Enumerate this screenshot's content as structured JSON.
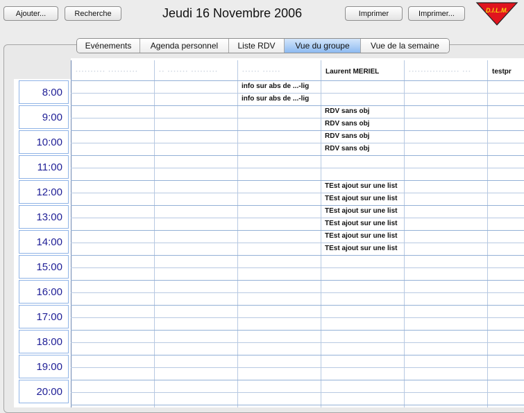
{
  "toolbar": {
    "add_label": "Ajouter...",
    "search_label": "Recherche",
    "date_title": "Jeudi 16 Novembre 2006",
    "print_label": "Imprimer",
    "print_more_label": "Imprimer..."
  },
  "logo": {
    "text": "D.I.L.M.",
    "color": "#e0141e",
    "text_color": "#f5d60a"
  },
  "tabs": [
    {
      "label": "Evénements",
      "active": false
    },
    {
      "label": "Agenda personnel",
      "active": false
    },
    {
      "label": "Liste RDV",
      "active": false
    },
    {
      "label": "Vue du groupe",
      "active": true
    },
    {
      "label": "Vue de la semaine",
      "active": false
    }
  ],
  "columns": [
    {
      "name": "·········· ··········",
      "redacted": true
    },
    {
      "name": "·· ······· ·········",
      "redacted": true
    },
    {
      "name": "······ ······",
      "redacted": true
    },
    {
      "name": "Laurent MERIEL",
      "redacted": false
    },
    {
      "name": "················· ···",
      "redacted": true
    },
    {
      "name": "testpr",
      "redacted": false
    }
  ],
  "times": [
    "8:00",
    "9:00",
    "10:00",
    "11:00",
    "12:00",
    "13:00",
    "14:00",
    "15:00",
    "16:00",
    "17:00",
    "18:00",
    "19:00",
    "20:00"
  ],
  "events": [
    {
      "column": 2,
      "slot": 0,
      "text": "info sur abs de ...-lig"
    },
    {
      "column": 2,
      "slot": 1,
      "text": "info sur abs de ...-lig"
    },
    {
      "column": 3,
      "slot": 2,
      "text": "RDV sans obj"
    },
    {
      "column": 3,
      "slot": 3,
      "text": "RDV sans obj"
    },
    {
      "column": 3,
      "slot": 4,
      "text": "RDV sans obj"
    },
    {
      "column": 3,
      "slot": 5,
      "text": "RDV sans obj"
    },
    {
      "column": 3,
      "slot": 8,
      "text": "TEst ajout sur une list"
    },
    {
      "column": 3,
      "slot": 9,
      "text": "TEst ajout sur une list"
    },
    {
      "column": 3,
      "slot": 10,
      "text": "TEst ajout sur une list"
    },
    {
      "column": 3,
      "slot": 11,
      "text": "TEst ajout sur une list"
    },
    {
      "column": 3,
      "slot": 12,
      "text": "TEst ajout sur une list"
    },
    {
      "column": 3,
      "slot": 13,
      "text": "TEst ajout sur une list"
    }
  ]
}
